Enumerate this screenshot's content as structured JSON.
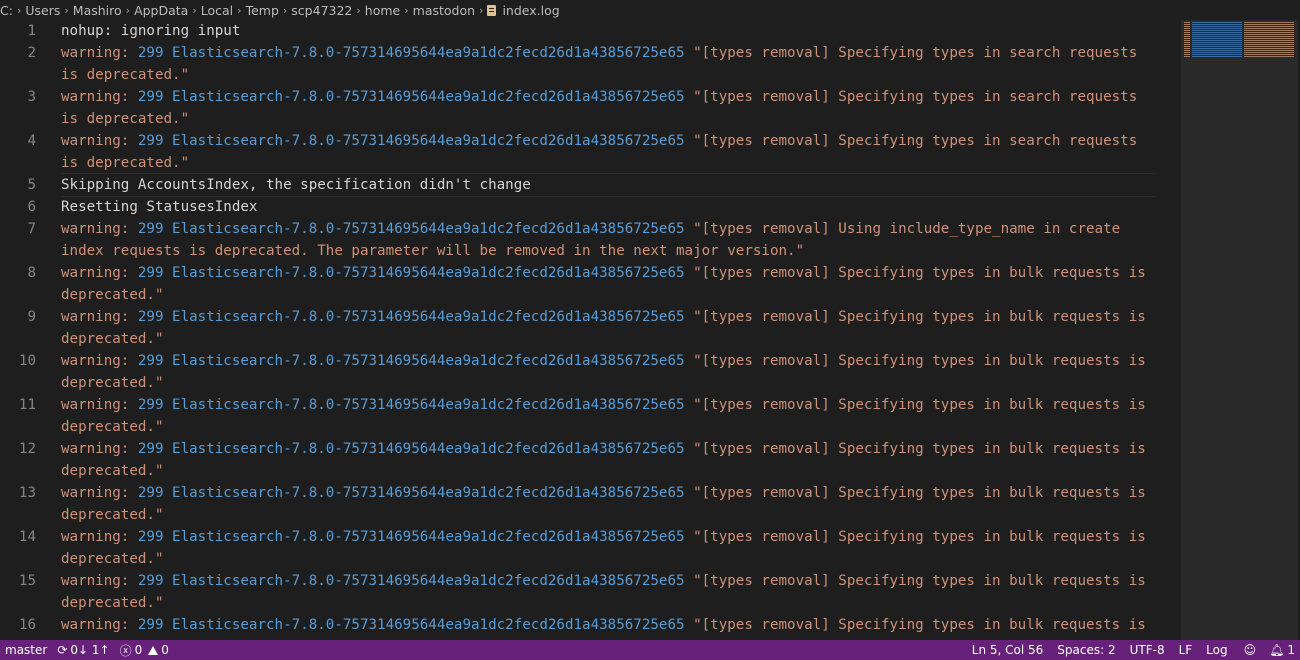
{
  "breadcrumb": {
    "parts": [
      "C:",
      "Users",
      "Mashiro",
      "AppData",
      "Local",
      "Temp",
      "scp47322",
      "home",
      "mastodon"
    ],
    "file": "index.log"
  },
  "lines": [
    {
      "num": "1",
      "segments": [
        {
          "t": "nohup: ignoring input",
          "c": "plain"
        }
      ]
    },
    {
      "num": "2",
      "segments": [
        {
          "t": "warning: ",
          "c": "warn-kw"
        },
        {
          "t": "299 ",
          "c": "num"
        },
        {
          "t": "Elasticsearch-7.8.0-757314695644ea9a1dc2fecd26d1a43856725e65 ",
          "c": "ver"
        },
        {
          "t": "\"[types removal] Specifying types in search requests is deprecated.\"",
          "c": "str"
        }
      ]
    },
    {
      "num": "3",
      "segments": [
        {
          "t": "warning: ",
          "c": "warn-kw"
        },
        {
          "t": "299 ",
          "c": "num"
        },
        {
          "t": "Elasticsearch-7.8.0-757314695644ea9a1dc2fecd26d1a43856725e65 ",
          "c": "ver"
        },
        {
          "t": "\"[types removal] Specifying types in search requests is deprecated.\"",
          "c": "str"
        }
      ]
    },
    {
      "num": "4",
      "segments": [
        {
          "t": "warning: ",
          "c": "warn-kw"
        },
        {
          "t": "299 ",
          "c": "num"
        },
        {
          "t": "Elasticsearch-7.8.0-757314695644ea9a1dc2fecd26d1a43856725e65 ",
          "c": "ver"
        },
        {
          "t": "\"[types removal] Specifying types in search requests is deprecated.\"",
          "c": "str"
        }
      ]
    },
    {
      "num": "5",
      "current": true,
      "segments": [
        {
          "t": "Skipping AccountsIndex, the specification didn't change",
          "c": "plain"
        }
      ]
    },
    {
      "num": "6",
      "segments": [
        {
          "t": "Resetting StatusesIndex",
          "c": "plain"
        }
      ]
    },
    {
      "num": "7",
      "segments": [
        {
          "t": "warning: ",
          "c": "warn-kw"
        },
        {
          "t": "299 ",
          "c": "num"
        },
        {
          "t": "Elasticsearch-7.8.0-757314695644ea9a1dc2fecd26d1a43856725e65 ",
          "c": "ver"
        },
        {
          "t": "\"[types removal] Using include_type_name in create index requests is deprecated. The parameter will be removed in the next major version.\"",
          "c": "str"
        }
      ]
    },
    {
      "num": "8",
      "segments": [
        {
          "t": "warning: ",
          "c": "warn-kw"
        },
        {
          "t": "299 ",
          "c": "num"
        },
        {
          "t": "Elasticsearch-7.8.0-757314695644ea9a1dc2fecd26d1a43856725e65 ",
          "c": "ver"
        },
        {
          "t": "\"[types removal] Specifying types in bulk requests is deprecated.\"",
          "c": "str"
        }
      ]
    },
    {
      "num": "9",
      "segments": [
        {
          "t": "warning: ",
          "c": "warn-kw"
        },
        {
          "t": "299 ",
          "c": "num"
        },
        {
          "t": "Elasticsearch-7.8.0-757314695644ea9a1dc2fecd26d1a43856725e65 ",
          "c": "ver"
        },
        {
          "t": "\"[types removal] Specifying types in bulk requests is deprecated.\"",
          "c": "str"
        }
      ]
    },
    {
      "num": "10",
      "segments": [
        {
          "t": "warning: ",
          "c": "warn-kw"
        },
        {
          "t": "299 ",
          "c": "num"
        },
        {
          "t": "Elasticsearch-7.8.0-757314695644ea9a1dc2fecd26d1a43856725e65 ",
          "c": "ver"
        },
        {
          "t": "\"[types removal] Specifying types in bulk requests is deprecated.\"",
          "c": "str"
        }
      ]
    },
    {
      "num": "11",
      "segments": [
        {
          "t": "warning: ",
          "c": "warn-kw"
        },
        {
          "t": "299 ",
          "c": "num"
        },
        {
          "t": "Elasticsearch-7.8.0-757314695644ea9a1dc2fecd26d1a43856725e65 ",
          "c": "ver"
        },
        {
          "t": "\"[types removal] Specifying types in bulk requests is deprecated.\"",
          "c": "str"
        }
      ]
    },
    {
      "num": "12",
      "segments": [
        {
          "t": "warning: ",
          "c": "warn-kw"
        },
        {
          "t": "299 ",
          "c": "num"
        },
        {
          "t": "Elasticsearch-7.8.0-757314695644ea9a1dc2fecd26d1a43856725e65 ",
          "c": "ver"
        },
        {
          "t": "\"[types removal] Specifying types in bulk requests is deprecated.\"",
          "c": "str"
        }
      ]
    },
    {
      "num": "13",
      "segments": [
        {
          "t": "warning: ",
          "c": "warn-kw"
        },
        {
          "t": "299 ",
          "c": "num"
        },
        {
          "t": "Elasticsearch-7.8.0-757314695644ea9a1dc2fecd26d1a43856725e65 ",
          "c": "ver"
        },
        {
          "t": "\"[types removal] Specifying types in bulk requests is deprecated.\"",
          "c": "str"
        }
      ]
    },
    {
      "num": "14",
      "segments": [
        {
          "t": "warning: ",
          "c": "warn-kw"
        },
        {
          "t": "299 ",
          "c": "num"
        },
        {
          "t": "Elasticsearch-7.8.0-757314695644ea9a1dc2fecd26d1a43856725e65 ",
          "c": "ver"
        },
        {
          "t": "\"[types removal] Specifying types in bulk requests is deprecated.\"",
          "c": "str"
        }
      ]
    },
    {
      "num": "15",
      "segments": [
        {
          "t": "warning: ",
          "c": "warn-kw"
        },
        {
          "t": "299 ",
          "c": "num"
        },
        {
          "t": "Elasticsearch-7.8.0-757314695644ea9a1dc2fecd26d1a43856725e65 ",
          "c": "ver"
        },
        {
          "t": "\"[types removal] Specifying types in bulk requests is deprecated.\"",
          "c": "str"
        }
      ]
    },
    {
      "num": "16",
      "segments": [
        {
          "t": "warning: ",
          "c": "warn-kw"
        },
        {
          "t": "299 ",
          "c": "num"
        },
        {
          "t": "Elasticsearch-7.8.0-757314695644ea9a1dc2fecd26d1a43856725e65 ",
          "c": "ver"
        },
        {
          "t": "\"[types removal] Specifying types in bulk requests is deprecated.\"",
          "c": "str"
        }
      ]
    }
  ],
  "statusbar": {
    "branch": "master",
    "sync": "0↓ 1↑",
    "errors": "0",
    "warnings": "0",
    "cursor": "Ln 5, Col 56",
    "spaces": "Spaces: 2",
    "encoding": "UTF-8",
    "eol": "LF",
    "language": "Log",
    "notifications": "1"
  },
  "colors": {
    "statusbar": "#68217a",
    "editor_bg": "#1e1e1e",
    "string": "#ce9178",
    "keyword": "#569cd6"
  }
}
